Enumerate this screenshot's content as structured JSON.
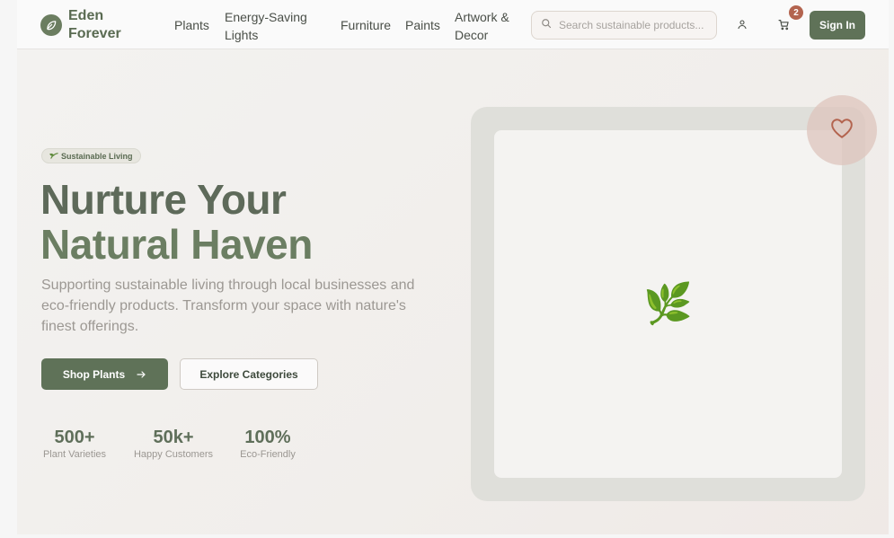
{
  "brand": {
    "name": "Eden Forever"
  },
  "nav": {
    "items": [
      {
        "label": "Plants"
      },
      {
        "label": "Energy-Saving Lights"
      },
      {
        "label": "Furniture"
      },
      {
        "label": "Paints"
      },
      {
        "label": "Artwork & Decor"
      }
    ]
  },
  "search": {
    "placeholder": "Search sustainable products...",
    "value": ""
  },
  "cart": {
    "count": "2"
  },
  "signin": {
    "label": "Sign In"
  },
  "hero": {
    "pill": "Sustainable Living",
    "headline_line1": "Nurture Your",
    "headline_line2": "Natural Haven",
    "description": "Supporting sustainable living through local businesses and eco-friendly products. Transform your space with nature's finest offerings.",
    "primary_button": "Shop Plants",
    "secondary_button": "Explore Categories",
    "image_glyph": "🌿"
  },
  "stats": [
    {
      "value": "500+",
      "label": "Plant Varieties"
    },
    {
      "value": "50k+",
      "label": "Happy Customers"
    },
    {
      "value": "100%",
      "label": "Eco-Friendly"
    }
  ],
  "colors": {
    "accent": "#5f7258",
    "badge": "#b3644f",
    "heart": "#b3644f"
  },
  "icons": [
    "leaf-icon",
    "search-icon",
    "user-icon",
    "cart-icon",
    "arrow-right-icon",
    "heart-icon",
    "sprout-icon"
  ]
}
